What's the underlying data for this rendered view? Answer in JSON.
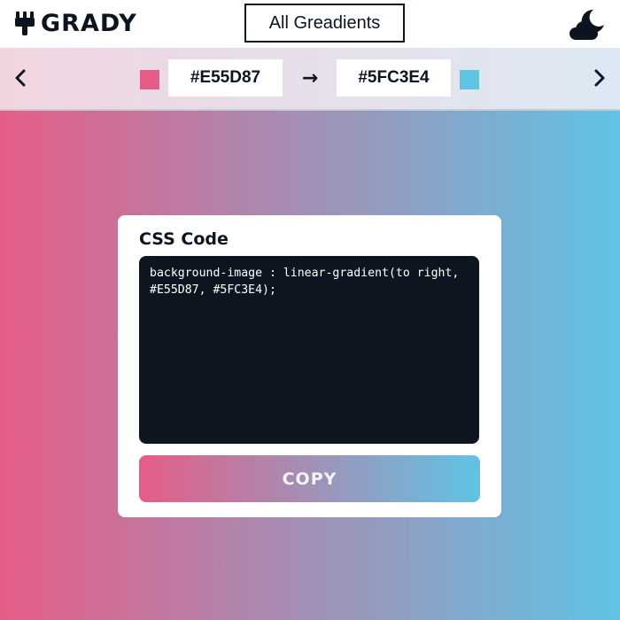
{
  "header": {
    "brand": "GRADY",
    "all_gradients_label": "All Greadients"
  },
  "colorbar": {
    "start_hex": "#E55D87",
    "end_hex": "#5FC3E4",
    "direction_symbol": "→"
  },
  "gradient": {
    "start": "#E55D87",
    "end": "#5FC3E4",
    "direction": "to right"
  },
  "card": {
    "title": "CSS Code",
    "code": "background-image : linear-gradient(to right, #E55D87, #5FC3E4);",
    "copy_label": "COPY"
  },
  "icons": {
    "logo": "paint-brush-icon",
    "theme_toggle": "moon-cloud-icon",
    "prev": "chevron-left-icon",
    "next": "chevron-right-icon"
  },
  "colors": {
    "text_dark": "#0c1420",
    "code_bg": "#0d1620"
  }
}
